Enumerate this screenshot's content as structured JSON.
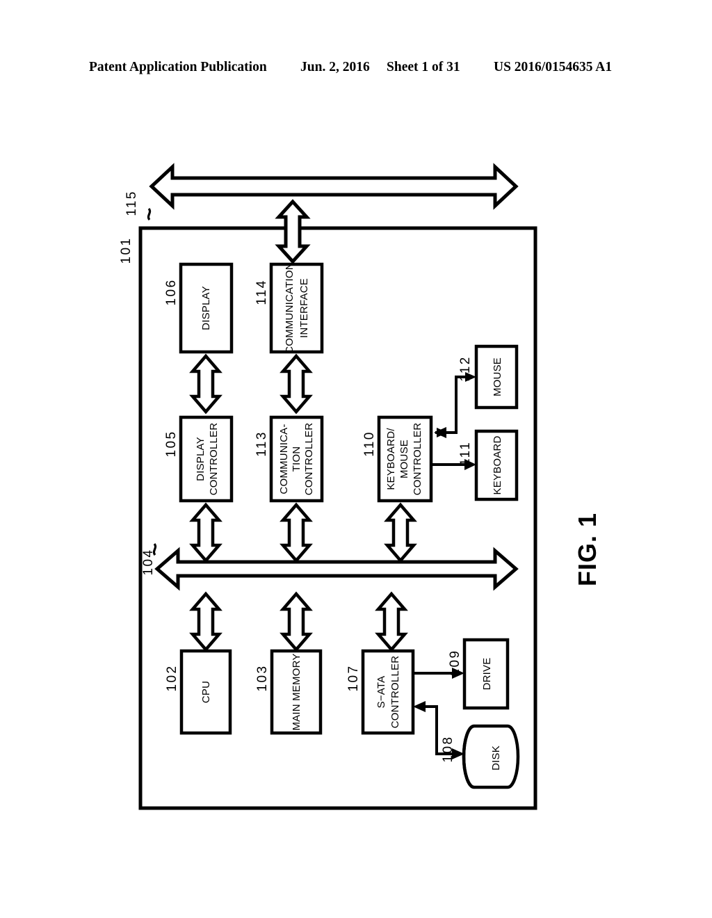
{
  "header": {
    "publication": "Patent Application Publication",
    "date": "Jun. 2, 2016",
    "sheet": "Sheet 1 of 31",
    "document_number": "US 2016/0154635 A1"
  },
  "figure": {
    "title": "FIG. 1",
    "orientation": "landscape-rotated-90",
    "enclosure": {
      "ref": "101",
      "description": "computer system outer boundary"
    },
    "buses": [
      {
        "ref": "115",
        "label": "",
        "type": "external-bus",
        "arrow": "double-headed-hollow-horizontal"
      },
      {
        "ref": "104",
        "label": "",
        "type": "internal-bus",
        "arrow": "double-headed-hollow-horizontal"
      }
    ],
    "blocks": [
      {
        "ref": "106",
        "label": "DISPLAY",
        "shape": "rect"
      },
      {
        "ref": "105",
        "label": "DISPLAY\nCONTROLLER",
        "shape": "rect"
      },
      {
        "ref": "114",
        "label": "COMMUNICATION\nINTERFACE",
        "shape": "rect"
      },
      {
        "ref": "113",
        "label": "COMMUNICA-\nTION\nCONTROLLER",
        "shape": "rect"
      },
      {
        "ref": "110",
        "label": "KEYBOARD/\nMOUSE\nCONTROLLER",
        "shape": "rect"
      },
      {
        "ref": "112",
        "label": "MOUSE",
        "shape": "rect"
      },
      {
        "ref": "111",
        "label": "KEYBOARD",
        "shape": "rect"
      },
      {
        "ref": "102",
        "label": "CPU",
        "shape": "rect"
      },
      {
        "ref": "103",
        "label": "MAIN MEMORY",
        "shape": "rect"
      },
      {
        "ref": "107",
        "label": "S−ATA\nCONTROLLER",
        "shape": "rect"
      },
      {
        "ref": "109",
        "label": "DRIVE",
        "shape": "rect"
      },
      {
        "ref": "108",
        "label": "DISK",
        "shape": "cylinder"
      }
    ],
    "block_text": {
      "display": "DISPLAY",
      "display_controller_l1": "DISPLAY",
      "display_controller_l2": "CONTROLLER",
      "communication_interface_l1": "COMMUNICATION",
      "communication_interface_l2": "INTERFACE",
      "communication_controller_l1": "COMMUNICA-",
      "communication_controller_l2": "TION",
      "communication_controller_l3": "CONTROLLER",
      "km_controller_l1": "KEYBOARD/",
      "km_controller_l2": "MOUSE",
      "km_controller_l3": "CONTROLLER",
      "mouse": "MOUSE",
      "keyboard": "KEYBOARD",
      "cpu": "CPU",
      "main_memory": "MAIN MEMORY",
      "sata_controller_l1": "S−ATA",
      "sata_controller_l2": "CONTROLLER",
      "drive": "DRIVE",
      "disk": "DISK"
    },
    "ref_numbers": {
      "n101": "101",
      "n102": "102",
      "n103": "103",
      "n104": "104",
      "n105": "105",
      "n106": "106",
      "n107": "107",
      "n108": "108",
      "n109": "109",
      "n110": "110",
      "n111": "111",
      "n112": "112",
      "n113": "113",
      "n114": "114",
      "n115": "115"
    },
    "colors": {
      "ink": "#000000",
      "paper": "#ffffff"
    }
  }
}
